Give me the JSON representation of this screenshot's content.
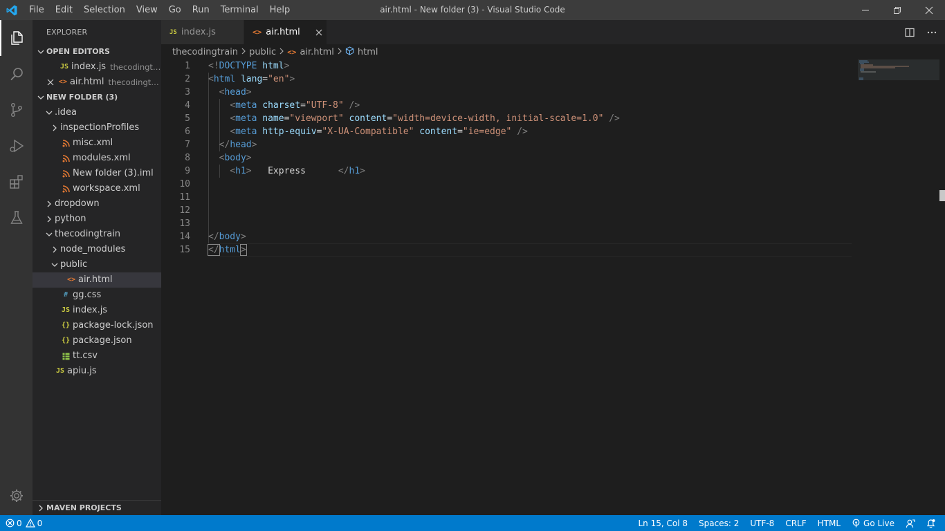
{
  "window": {
    "title": "air.html - New folder (3) - Visual Studio Code",
    "menu": [
      "File",
      "Edit",
      "Selection",
      "View",
      "Go",
      "Run",
      "Terminal",
      "Help"
    ]
  },
  "sidebar": {
    "title": "EXPLORER",
    "open_editors": {
      "label": "OPEN EDITORS",
      "items": [
        {
          "name": "index.js",
          "desc": "thecodingtrain",
          "icon": "JS"
        },
        {
          "name": "air.html",
          "desc": "thecodingtrai...",
          "icon": "<>"
        }
      ]
    },
    "folder": {
      "label": "NEW FOLDER (3)",
      "tree": [
        {
          "label": ".idea",
          "depth": 1,
          "chev": "down",
          "icon": ""
        },
        {
          "label": "inspectionProfiles",
          "depth": 2,
          "chev": "right",
          "icon": ""
        },
        {
          "label": "misc.xml",
          "depth": 2,
          "chev": "",
          "icon": "rss"
        },
        {
          "label": "modules.xml",
          "depth": 2,
          "chev": "",
          "icon": "rss"
        },
        {
          "label": "New folder (3).iml",
          "depth": 2,
          "chev": "",
          "icon": "rss"
        },
        {
          "label": "workspace.xml",
          "depth": 2,
          "chev": "",
          "icon": "rss"
        },
        {
          "label": "dropdown",
          "depth": 1,
          "chev": "right",
          "icon": ""
        },
        {
          "label": "python",
          "depth": 1,
          "chev": "right",
          "icon": ""
        },
        {
          "label": "thecodingtrain",
          "depth": 1,
          "chev": "down",
          "icon": ""
        },
        {
          "label": "node_modules",
          "depth": 2,
          "chev": "right",
          "icon": ""
        },
        {
          "label": "public",
          "depth": 2,
          "chev": "down",
          "icon": ""
        },
        {
          "label": "air.html",
          "depth": 3,
          "chev": "",
          "icon": "<>",
          "selected": true
        },
        {
          "label": "gg.css",
          "depth": 2,
          "chev": "",
          "icon": "#"
        },
        {
          "label": "index.js",
          "depth": 2,
          "chev": "",
          "icon": "JS"
        },
        {
          "label": "package-lock.json",
          "depth": 2,
          "chev": "",
          "icon": "{}"
        },
        {
          "label": "package.json",
          "depth": 2,
          "chev": "",
          "icon": "{}"
        },
        {
          "label": "tt.csv",
          "depth": 2,
          "chev": "",
          "icon": "csv"
        },
        {
          "label": "apiu.js",
          "depth": 1,
          "chev": "",
          "icon": "JS"
        }
      ]
    },
    "maven": {
      "label": "MAVEN PROJECTS"
    }
  },
  "tabs": [
    {
      "label": "index.js",
      "icon": "JS",
      "active": false
    },
    {
      "label": "air.html",
      "icon": "<>",
      "active": true
    }
  ],
  "breadcrumb": {
    "items": [
      "thecodingtrain",
      "public",
      "air.html",
      "html"
    ]
  },
  "editor": {
    "lines": [
      [
        [
          "brk",
          "<!"
        ],
        [
          "tag",
          "DOCTYPE"
        ],
        [
          "txt",
          " "
        ],
        [
          "attr",
          "html"
        ],
        [
          "brk",
          ">"
        ]
      ],
      [
        [
          "brk",
          "<"
        ],
        [
          "tag",
          "html"
        ],
        [
          "txt",
          " "
        ],
        [
          "attr",
          "lang"
        ],
        [
          "txt",
          "="
        ],
        [
          "str",
          "\"en\""
        ],
        [
          "brk",
          ">"
        ]
      ],
      [
        [
          "txt",
          "  "
        ],
        [
          "brk",
          "<"
        ],
        [
          "tag",
          "head"
        ],
        [
          "brk",
          ">"
        ]
      ],
      [
        [
          "txt",
          "    "
        ],
        [
          "brk",
          "<"
        ],
        [
          "tag",
          "meta"
        ],
        [
          "txt",
          " "
        ],
        [
          "attr",
          "charset"
        ],
        [
          "txt",
          "="
        ],
        [
          "str",
          "\"UTF-8\""
        ],
        [
          "txt",
          " "
        ],
        [
          "brk",
          "/>"
        ]
      ],
      [
        [
          "txt",
          "    "
        ],
        [
          "brk",
          "<"
        ],
        [
          "tag",
          "meta"
        ],
        [
          "txt",
          " "
        ],
        [
          "attr",
          "name"
        ],
        [
          "txt",
          "="
        ],
        [
          "str",
          "\"viewport\""
        ],
        [
          "txt",
          " "
        ],
        [
          "attr",
          "content"
        ],
        [
          "txt",
          "="
        ],
        [
          "str",
          "\"width=device-width, initial-scale=1.0\""
        ],
        [
          "txt",
          " "
        ],
        [
          "brk",
          "/>"
        ]
      ],
      [
        [
          "txt",
          "    "
        ],
        [
          "brk",
          "<"
        ],
        [
          "tag",
          "meta"
        ],
        [
          "txt",
          " "
        ],
        [
          "attr",
          "http-equiv"
        ],
        [
          "txt",
          "="
        ],
        [
          "str",
          "\"X-UA-Compatible\""
        ],
        [
          "txt",
          " "
        ],
        [
          "attr",
          "content"
        ],
        [
          "txt",
          "="
        ],
        [
          "str",
          "\"ie=edge\""
        ],
        [
          "txt",
          " "
        ],
        [
          "brk",
          "/>"
        ]
      ],
      [
        [
          "txt",
          "  "
        ],
        [
          "brk",
          "</"
        ],
        [
          "tag",
          "head"
        ],
        [
          "brk",
          ">"
        ]
      ],
      [
        [
          "txt",
          "  "
        ],
        [
          "brk",
          "<"
        ],
        [
          "tag",
          "body"
        ],
        [
          "brk",
          ">"
        ]
      ],
      [
        [
          "txt",
          "    "
        ],
        [
          "brk",
          "<"
        ],
        [
          "tag",
          "h1"
        ],
        [
          "brk",
          ">"
        ],
        [
          "txt",
          "   Express      "
        ],
        [
          "brk",
          "</"
        ],
        [
          "tag",
          "h1"
        ],
        [
          "brk",
          ">"
        ]
      ],
      [],
      [],
      [],
      [],
      [
        [
          "brk",
          "</"
        ],
        [
          "tag",
          "body"
        ],
        [
          "brk",
          ">"
        ]
      ],
      [
        [
          "brk",
          "</"
        ],
        [
          "tag",
          "html"
        ],
        [
          "brk",
          ">"
        ]
      ]
    ]
  },
  "status": {
    "errors": "0",
    "warnings": "0",
    "position": "Ln 15, Col 8",
    "spaces": "Spaces: 2",
    "encoding": "UTF-8",
    "eol": "CRLF",
    "language": "HTML",
    "golive": "Go Live"
  },
  "colors": {
    "accent": "#007acc",
    "activity_bar": "#333333",
    "sidebar": "#252526",
    "editor": "#1e1e1e"
  }
}
